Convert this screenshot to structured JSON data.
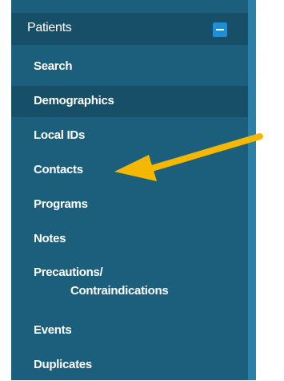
{
  "header": {
    "title": "Patients"
  },
  "menu": [
    "Search",
    "Demographics",
    "Local IDs",
    "Contacts",
    "Programs",
    "Notes",
    "Precautions/",
    "Contraindications",
    "Events",
    "Duplicates"
  ],
  "active_item": "Demographics",
  "colors": {
    "sidebar": "#1c5f7c",
    "active": "#174f69",
    "accent": "#1c8fd6",
    "arrow": "#f5b800"
  }
}
